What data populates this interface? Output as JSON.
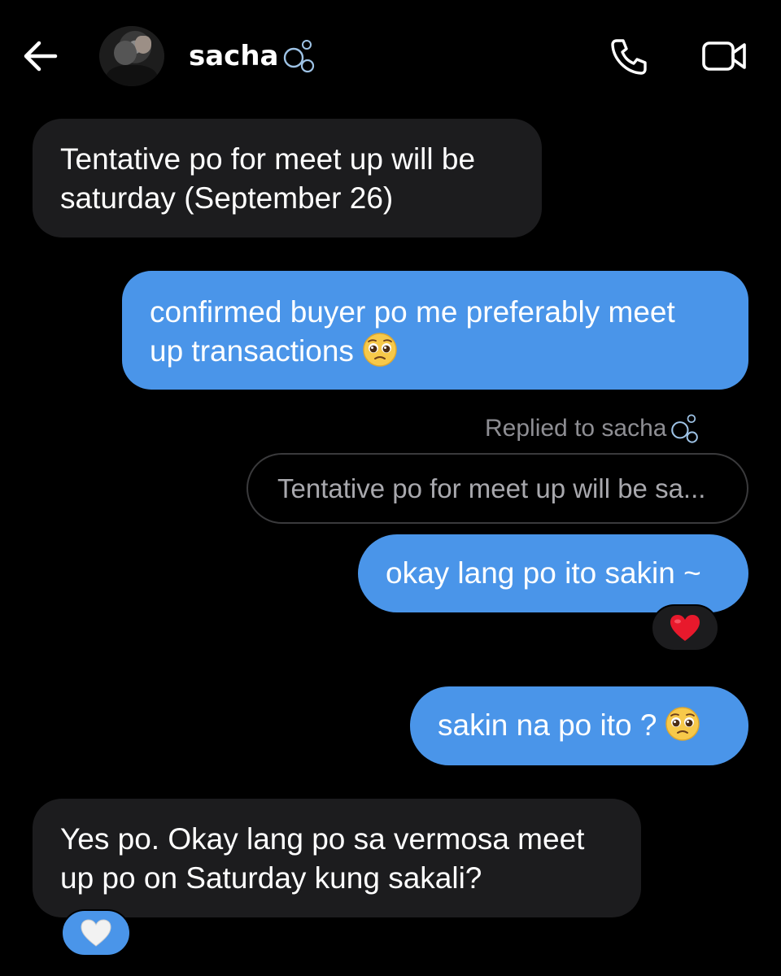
{
  "header": {
    "contact_name": "sacha",
    "name_decoration_icon": "bubbles-icon",
    "back_icon": "arrow-left-icon",
    "call_icon": "phone-icon",
    "video_icon": "video-camera-icon"
  },
  "messages": [
    {
      "direction": "received",
      "text_line1": "Tentative po for meet up will be",
      "text_line2": "saturday (September 26)"
    },
    {
      "direction": "sent",
      "text_line1": "confirmed buyer po me preferably meet",
      "text_line2": "up transactions",
      "emoji": "pleading-face"
    },
    {
      "direction": "sent",
      "reply_label": "Replied to sacha",
      "quoted_text": "Tentative po for meet up will be sa...",
      "text": "okay lang po ito sakin ~",
      "reaction": "red-heart"
    },
    {
      "direction": "sent",
      "text": "sakin na po ito ?",
      "emoji": "pleading-face"
    },
    {
      "direction": "received",
      "text_line1": "Yes po. Okay lang po sa vermosa meet",
      "text_line2": "up po on Saturday kung sakali?",
      "reaction": "white-heart"
    }
  ],
  "colors": {
    "background": "#000000",
    "sent_bubble": "#4a95e9",
    "received_bubble": "#1c1c1e",
    "muted_text": "#8e8e93"
  }
}
